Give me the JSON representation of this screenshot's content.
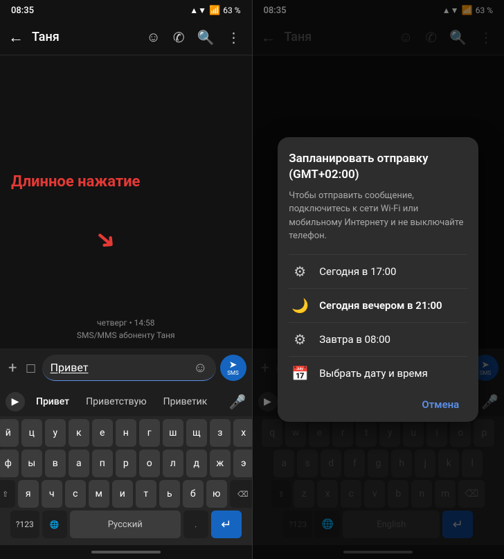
{
  "left": {
    "status": {
      "time": "08:35",
      "signal": "▲▼",
      "wifi": "📶",
      "battery": "63 %"
    },
    "topbar": {
      "back": "←",
      "title": "Таня",
      "icon_emoji": "☺",
      "icon_call": "✆",
      "icon_search": "🔍",
      "icon_more": "⋮"
    },
    "chat": {
      "long_press_line1": "Длинное нажатие",
      "timestamp": "четверг • 14:58",
      "sms_notice": "SMS/MMS абоненту Таня"
    },
    "input": {
      "plus_icon": "+",
      "sticker_icon": "⊡",
      "text_value": "Привет",
      "emoji_icon": "☺",
      "send_label": "SMS"
    },
    "suggestions": {
      "arrow": "▶",
      "words": [
        "Привет",
        "Приветствую",
        "Приветик"
      ],
      "mic": "🎤"
    },
    "keyboard": {
      "row1": [
        "й",
        "ц",
        "у",
        "к",
        "е",
        "н",
        "г",
        "ш",
        "щ",
        "з",
        "х"
      ],
      "row2": [
        "ф",
        "ы",
        "в",
        "а",
        "п",
        "р",
        "о",
        "л",
        "д",
        "ж",
        "э"
      ],
      "row3_special_left": "⇧",
      "row3": [
        "я",
        "ч",
        "с",
        "м",
        "и",
        "т",
        "ь",
        "б",
        "ю"
      ],
      "row3_backspace": "⌫",
      "row4_numbers": "?123",
      "row4_globe": "🌐",
      "row4_space": "Русский",
      "row4_period": ".",
      "row4_enter": "↵"
    }
  },
  "right": {
    "status": {
      "time": "08:35",
      "signal": "▲▼",
      "battery": "63 %"
    },
    "topbar": {
      "back": "←",
      "title": "Таня",
      "icon_emoji": "☺",
      "icon_call": "✆",
      "icon_search": "🔍",
      "icon_more": "⋮"
    },
    "dialog": {
      "title": "Запланировать отправку\n(GMT+02:00)",
      "subtitle": "Чтобы отправить сообщение, подключитесь к сети Wi-Fi или мобильному Интернету и не выключайте телефон.",
      "options": [
        {
          "icon": "⚙",
          "text": "Сегодня в 17:00",
          "bold": false
        },
        {
          "icon": "🌙",
          "text": "Сегодня вечером в 21:00",
          "bold": true
        },
        {
          "icon": "⚙",
          "text": "Завтра в 08:00",
          "bold": false
        },
        {
          "icon": "📅",
          "text": "Выбрать дату и время",
          "bold": false
        }
      ],
      "cancel_label": "Отмена"
    },
    "input": {
      "plus_icon": "+",
      "send_label": "SMS"
    },
    "keyboard": {
      "row4_numbers": "?123",
      "row4_globe": "🌐",
      "row4_space": "English",
      "row4_enter": "↵"
    }
  }
}
